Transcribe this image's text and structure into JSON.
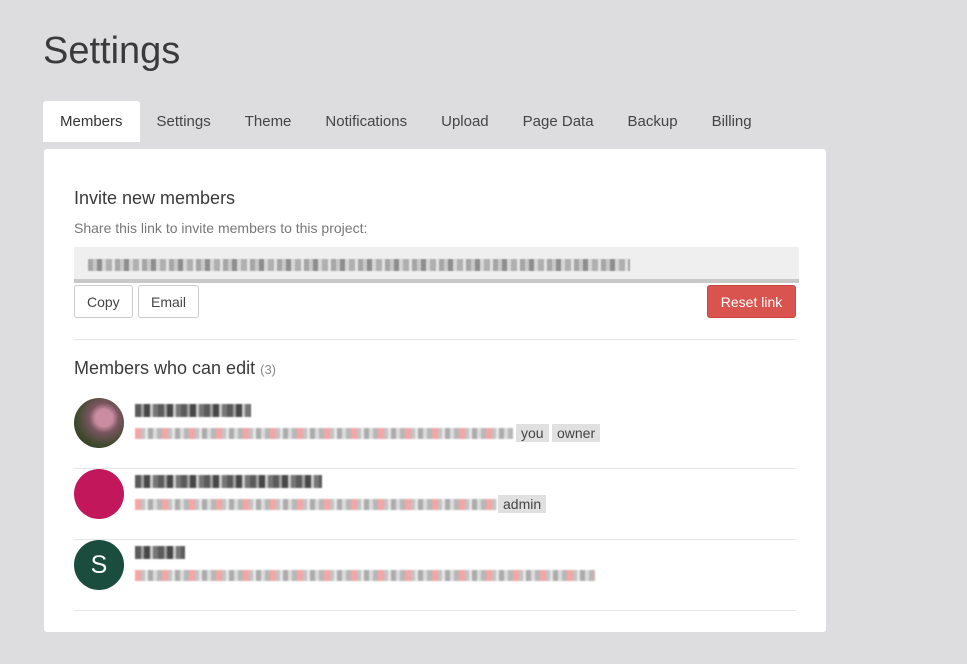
{
  "page": {
    "title": "Settings"
  },
  "tabs": [
    {
      "label": "Members",
      "active": true
    },
    {
      "label": "Settings"
    },
    {
      "label": "Theme"
    },
    {
      "label": "Notifications"
    },
    {
      "label": "Upload"
    },
    {
      "label": "Page Data"
    },
    {
      "label": "Backup"
    },
    {
      "label": "Billing"
    }
  ],
  "invite": {
    "title": "Invite new members",
    "description": "Share this link to invite members to this project:",
    "copy_label": "Copy",
    "email_label": "Email",
    "reset_label": "Reset link"
  },
  "members": {
    "title": "Members who can edit",
    "count": "(3)",
    "list": [
      {
        "avatar_type": "photo",
        "badges": [
          "you",
          "owner"
        ]
      },
      {
        "avatar_type": "solid",
        "badges": [
          "admin"
        ]
      },
      {
        "avatar_type": "initial",
        "initial": "S",
        "badges": []
      }
    ]
  },
  "colors": {
    "background": "#dddde0",
    "danger": "#d9534f",
    "avatar_magenta": "#c2185b",
    "avatar_green": "#1b4d3e"
  }
}
